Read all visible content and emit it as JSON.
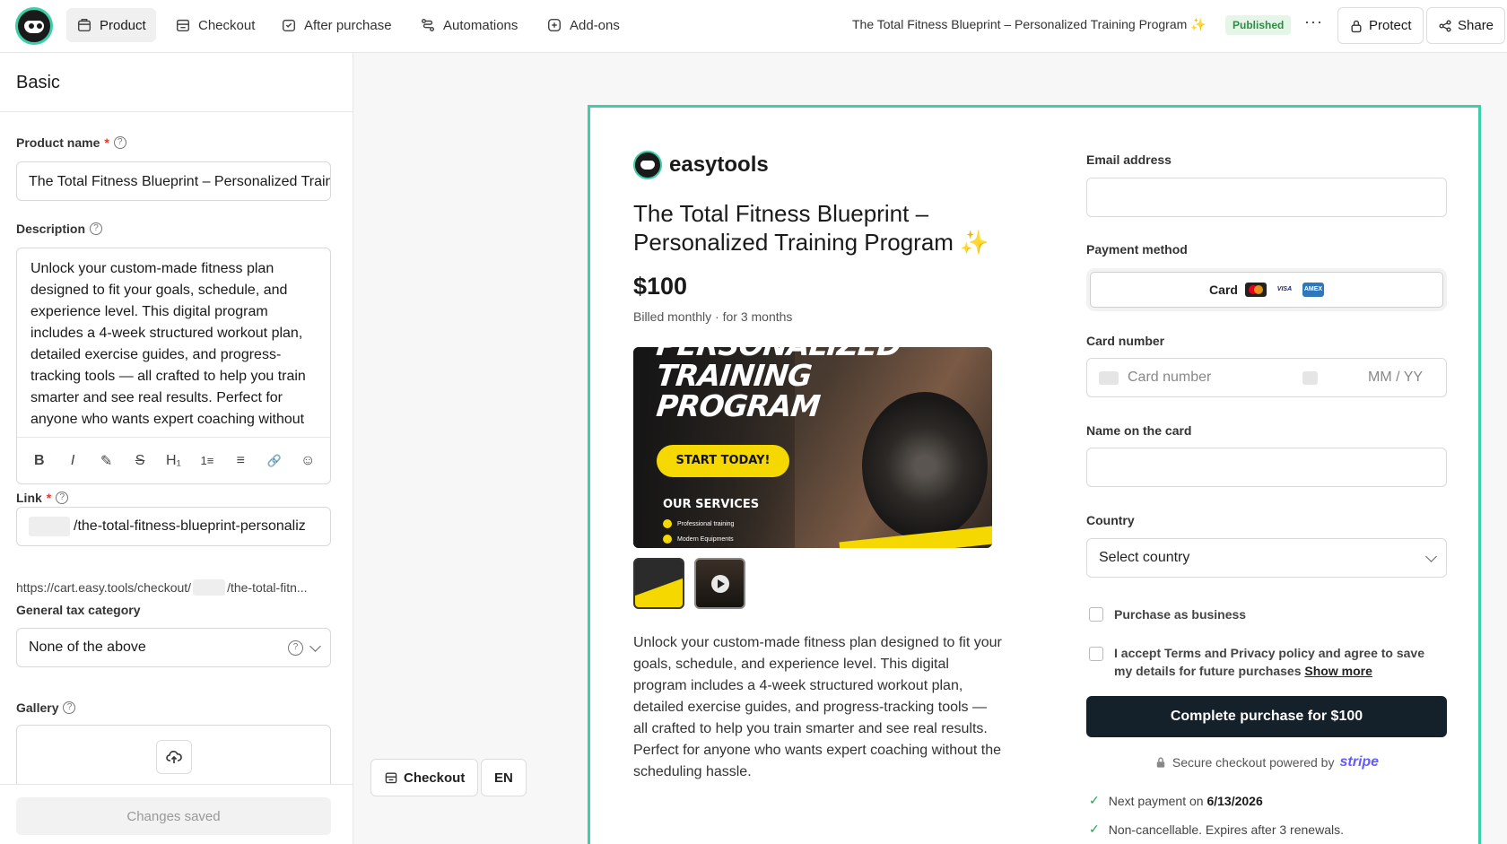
{
  "topbar": {
    "nav": [
      {
        "label": "Product"
      },
      {
        "label": "Checkout"
      },
      {
        "label": "After purchase"
      },
      {
        "label": "Automations"
      },
      {
        "label": "Add-ons"
      }
    ],
    "doc_title": "The Total Fitness Blueprint – Personalized Training Program ✨",
    "status": "Published",
    "more": "···",
    "protect_label": "Protect",
    "share_label": "Share"
  },
  "sidebar": {
    "section_title": "Basic",
    "product_name_label": "Product name",
    "required_mark": "*",
    "product_name_value": "The Total Fitness Blueprint – Personalized Training Program ✨",
    "description_label": "Description",
    "description_value": "Unlock your custom-made fitness plan designed to fit your goals, schedule, and experience level. This digital program includes a 4-week structured workout plan, detailed exercise guides, and progress-tracking tools — all crafted to help you train smarter and see real results. Perfect for anyone who wants expert coaching without the scheduling hassle.",
    "toolbar": [
      "B",
      "I",
      "✎",
      "S",
      "H₁",
      "1≡",
      "≡",
      "🔗",
      "☺"
    ],
    "link_label": "Link",
    "link_value": "/the-total-fitness-blueprint-personaliz",
    "link_url_prefix": "https://cart.easy.tools/checkout/",
    "link_url_suffix": "/the-total-fitn...",
    "tax_label": "General tax category",
    "tax_value": "None of the above",
    "gallery_label": "Gallery",
    "saved_label": "Changes saved"
  },
  "canvas": {
    "checkout_pill": "Checkout",
    "lang_pill": "EN"
  },
  "preview": {
    "brand": "easytools",
    "title": "The Total Fitness Blueprint – Personalized Training Program ✨",
    "price": "$100",
    "billed": "Billed monthly · for 3 months",
    "hero": {
      "line1": "PERSONALIZED",
      "line2": "TRAINING",
      "line3": "PROGRAM",
      "cta": "START TODAY!",
      "services_title": "OUR SERVICES",
      "services": [
        "Professional training",
        "Modern Equipments"
      ]
    },
    "description": "Unlock your custom-made fitness plan designed to fit your goals, schedule, and experience level. This digital program includes a 4-week structured workout plan, detailed exercise guides, and progress-tracking tools — all crafted to help you train smarter and see real results. Perfect for anyone who wants expert coaching without the scheduling hassle.",
    "form": {
      "email_label": "Email address",
      "payment_label": "Payment method",
      "card_tab": "Card",
      "card_brands": [
        "MC",
        "VISA",
        "AMEX"
      ],
      "card_number_label": "Card number",
      "card_number_placeholder": "Card number",
      "expiry_placeholder": "MM / YY",
      "name_label": "Name on the card",
      "country_label": "Country",
      "country_placeholder": "Select country",
      "business_label": "Purchase as business",
      "terms_text": "I accept Terms and Privacy policy and agree to save my details for future purchases",
      "show_more": "Show more",
      "buy_button": "Complete purchase for $100",
      "secure_text": "Secure checkout powered by",
      "stripe": "stripe",
      "next_payment_text": "Next payment on",
      "next_payment_date": "6/13/2026",
      "non_cancel_text": "Non-cancellable. Expires after 3 renewals."
    }
  },
  "colors": {
    "accent": "#3ccfa8",
    "primary_button": "#14202a",
    "published_bg": "#e5f6e9",
    "published_text": "#2f8a45",
    "hero_yellow": "#f5d800",
    "stripe": "#635bff"
  }
}
